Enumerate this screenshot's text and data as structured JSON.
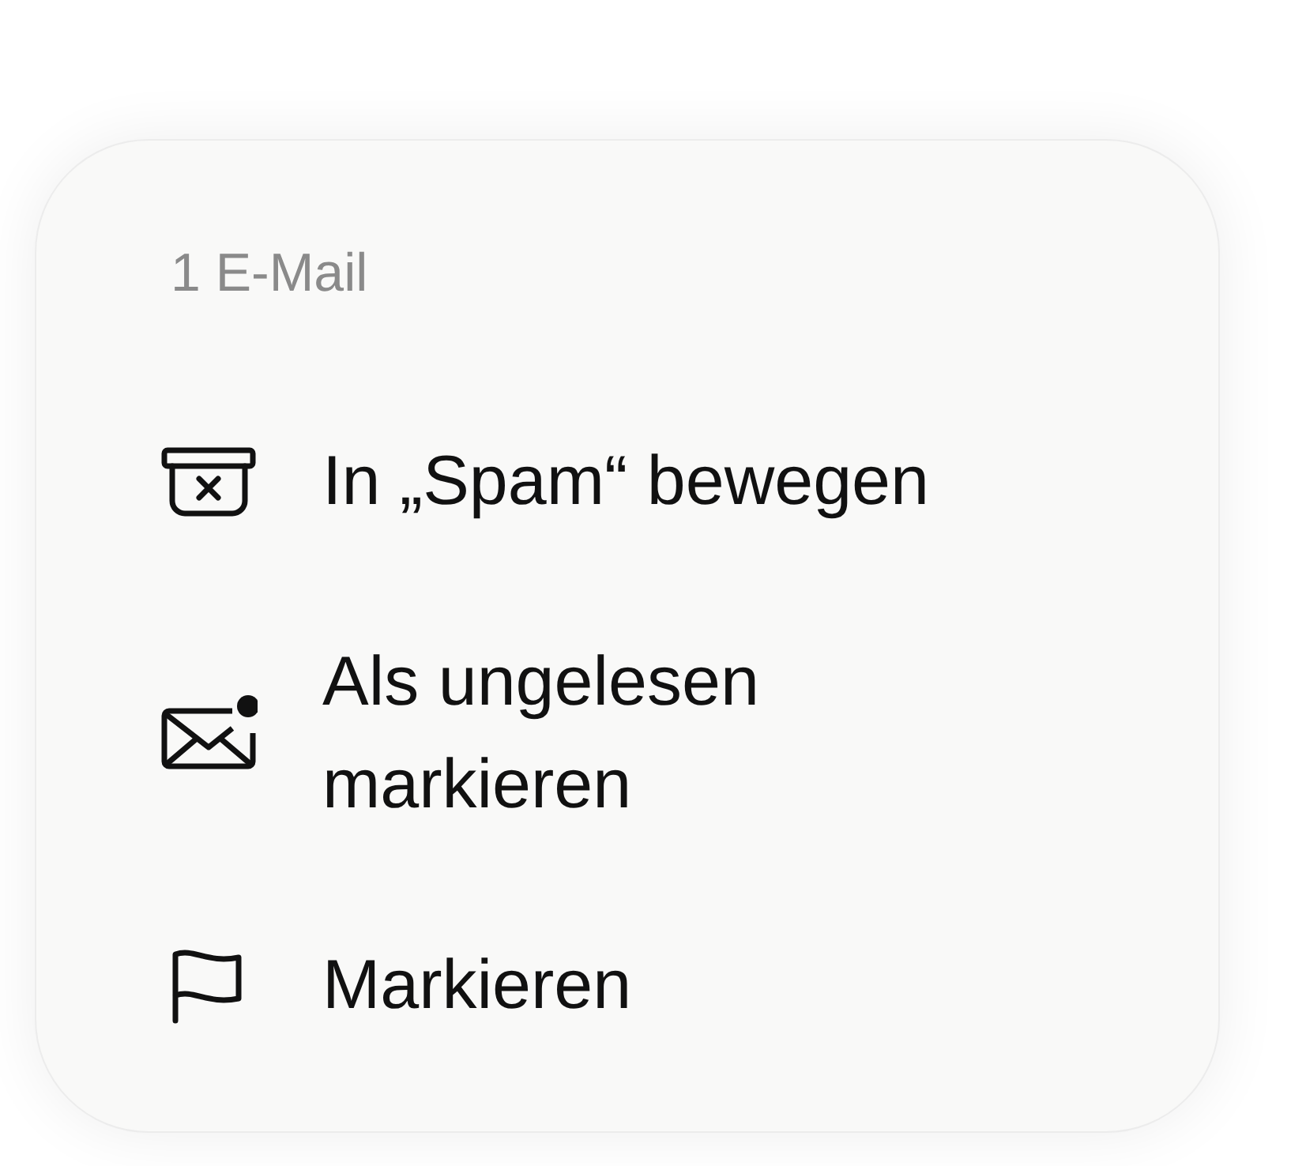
{
  "menu": {
    "header": "1 E-Mail",
    "items": [
      {
        "kind": "spam",
        "label": "In „Spam“ bewegen"
      },
      {
        "kind": "unread",
        "label": "Als ungelesen markieren"
      },
      {
        "kind": "flag",
        "label": "Markieren"
      }
    ]
  }
}
